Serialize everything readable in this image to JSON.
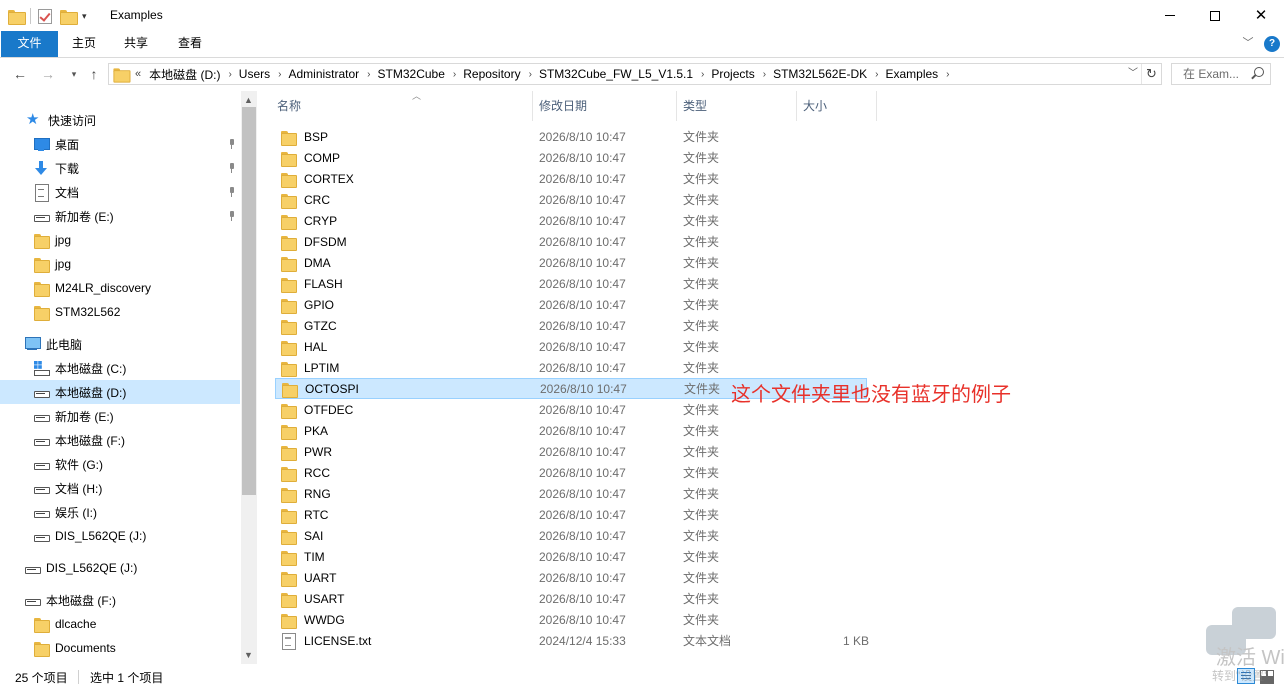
{
  "window": {
    "title": "Examples",
    "minimize_glyph": "—",
    "maximize_glyph": "□",
    "close_glyph": "✕"
  },
  "ribbon": {
    "tabs": [
      "文件",
      "主页",
      "共享",
      "查看"
    ],
    "help_glyph": "?"
  },
  "address": {
    "overflow": "«",
    "path": [
      "本地磁盘 (D:)",
      "Users",
      "Administrator",
      "STM32Cube",
      "Repository",
      "STM32Cube_FW_L5_V1.5.1",
      "Projects",
      "STM32L562E-DK",
      "Examples"
    ],
    "search_placeholder": "在 Exam..."
  },
  "nav": {
    "quick_access": "快速访问",
    "items": [
      {
        "label": "桌面",
        "icon": "desktop-icon",
        "pinned": true
      },
      {
        "label": "下载",
        "icon": "download-icon",
        "pinned": true
      },
      {
        "label": "文档",
        "icon": "document-icon",
        "pinned": true
      },
      {
        "label": "新加卷 (E:)",
        "icon": "drive-icon",
        "pinned": true
      },
      {
        "label": "jpg",
        "icon": "folder-icon"
      },
      {
        "label": "jpg",
        "icon": "folder-icon"
      },
      {
        "label": "M24LR_discovery",
        "icon": "folder-icon"
      },
      {
        "label": "STM32L562",
        "icon": "folder-icon"
      }
    ],
    "this_pc": "此电脑",
    "drives": [
      {
        "label": "本地磁盘 (C:)",
        "icon": "windows-drive-icon"
      },
      {
        "label": "本地磁盘 (D:)",
        "icon": "drive-icon",
        "selected": true
      },
      {
        "label": "新加卷 (E:)",
        "icon": "drive-icon"
      },
      {
        "label": "本地磁盘 (F:)",
        "icon": "drive-icon"
      },
      {
        "label": "软件 (G:)",
        "icon": "drive-icon"
      },
      {
        "label": "文档 (H:)",
        "icon": "drive-icon"
      },
      {
        "label": "娱乐 (I:)",
        "icon": "drive-icon"
      },
      {
        "label": "DIS_L562QE (J:)",
        "icon": "drive-icon"
      }
    ],
    "dis_drive": "DIS_L562QE (J:)",
    "f_drive": "本地磁盘 (F:)",
    "f_children": [
      "dlcache",
      "Documents"
    ]
  },
  "columns": {
    "name": "名称",
    "date": "修改日期",
    "type": "类型",
    "size": "大小"
  },
  "files": [
    {
      "name": "BSP",
      "date": "2026/8/10 10:47",
      "type": "文件夹",
      "size": "",
      "kind": "folder"
    },
    {
      "name": "COMP",
      "date": "2026/8/10 10:47",
      "type": "文件夹",
      "size": "",
      "kind": "folder"
    },
    {
      "name": "CORTEX",
      "date": "2026/8/10 10:47",
      "type": "文件夹",
      "size": "",
      "kind": "folder"
    },
    {
      "name": "CRC",
      "date": "2026/8/10 10:47",
      "type": "文件夹",
      "size": "",
      "kind": "folder"
    },
    {
      "name": "CRYP",
      "date": "2026/8/10 10:47",
      "type": "文件夹",
      "size": "",
      "kind": "folder"
    },
    {
      "name": "DFSDM",
      "date": "2026/8/10 10:47",
      "type": "文件夹",
      "size": "",
      "kind": "folder"
    },
    {
      "name": "DMA",
      "date": "2026/8/10 10:47",
      "type": "文件夹",
      "size": "",
      "kind": "folder"
    },
    {
      "name": "FLASH",
      "date": "2026/8/10 10:47",
      "type": "文件夹",
      "size": "",
      "kind": "folder"
    },
    {
      "name": "GPIO",
      "date": "2026/8/10 10:47",
      "type": "文件夹",
      "size": "",
      "kind": "folder"
    },
    {
      "name": "GTZC",
      "date": "2026/8/10 10:47",
      "type": "文件夹",
      "size": "",
      "kind": "folder"
    },
    {
      "name": "HAL",
      "date": "2026/8/10 10:47",
      "type": "文件夹",
      "size": "",
      "kind": "folder"
    },
    {
      "name": "LPTIM",
      "date": "2026/8/10 10:47",
      "type": "文件夹",
      "size": "",
      "kind": "folder"
    },
    {
      "name": "OCTOSPI",
      "date": "2026/8/10 10:47",
      "type": "文件夹",
      "size": "",
      "kind": "folder",
      "selected": true
    },
    {
      "name": "OTFDEC",
      "date": "2026/8/10 10:47",
      "type": "文件夹",
      "size": "",
      "kind": "folder"
    },
    {
      "name": "PKA",
      "date": "2026/8/10 10:47",
      "type": "文件夹",
      "size": "",
      "kind": "folder"
    },
    {
      "name": "PWR",
      "date": "2026/8/10 10:47",
      "type": "文件夹",
      "size": "",
      "kind": "folder"
    },
    {
      "name": "RCC",
      "date": "2026/8/10 10:47",
      "type": "文件夹",
      "size": "",
      "kind": "folder"
    },
    {
      "name": "RNG",
      "date": "2026/8/10 10:47",
      "type": "文件夹",
      "size": "",
      "kind": "folder"
    },
    {
      "name": "RTC",
      "date": "2026/8/10 10:47",
      "type": "文件夹",
      "size": "",
      "kind": "folder"
    },
    {
      "name": "SAI",
      "date": "2026/8/10 10:47",
      "type": "文件夹",
      "size": "",
      "kind": "folder"
    },
    {
      "name": "TIM",
      "date": "2026/8/10 10:47",
      "type": "文件夹",
      "size": "",
      "kind": "folder"
    },
    {
      "name": "UART",
      "date": "2026/8/10 10:47",
      "type": "文件夹",
      "size": "",
      "kind": "folder"
    },
    {
      "name": "USART",
      "date": "2026/8/10 10:47",
      "type": "文件夹",
      "size": "",
      "kind": "folder"
    },
    {
      "name": "WWDG",
      "date": "2026/8/10 10:47",
      "type": "文件夹",
      "size": "",
      "kind": "folder"
    },
    {
      "name": "LICENSE.txt",
      "date": "2024/12/4 15:33",
      "type": "文本文档",
      "size": "1 KB",
      "kind": "text"
    }
  ],
  "annotation": "这个文件夹里也没有蓝牙的例子",
  "status": {
    "count": "25 个项目",
    "selection": "选中 1 个项目"
  },
  "watermark": {
    "line1": "激活 Wi",
    "line2": "转到\"设置\""
  },
  "colors": {
    "accent": "#1979ca",
    "selection": "#cce8ff",
    "annotation": "#e8312a"
  }
}
